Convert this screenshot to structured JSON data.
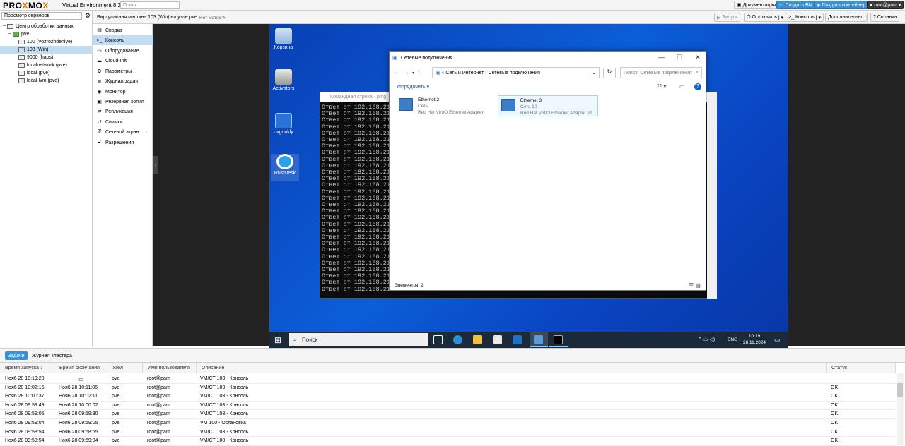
{
  "topbar": {
    "logo_a": "PRO",
    "logo_b": "X",
    "logo_c": "MO",
    "logo_d": "X",
    "version": "Virtual Environment 8.2.2",
    "search_placeholder": "Поиск",
    "docs": "Документация",
    "create_vm": "Создать ВМ",
    "create_ct": "Создать контейнер",
    "user": "root@pam"
  },
  "tree": {
    "view": "Просмотр серверов",
    "items": [
      "Центр обработки данных",
      "pve",
      "100 (Vozrozhdeniye)",
      "103 (Win)",
      "9000 (haos)",
      "localnetwork (pve)",
      "local (pve)",
      "local-lvm (pve)"
    ]
  },
  "vmhead": {
    "title": "Виртуальная машина 103 (Win) на узле pve",
    "tags": "Нет меток",
    "start": "Запуск",
    "shutdown": "Отключить",
    "console": "Консоль",
    "more": "Дополнительно",
    "help": "Справка"
  },
  "menu": [
    "Сводка",
    "Консоль",
    "Оборудование",
    "Cloud-Init",
    "Параметры",
    "Журнал задач",
    "Монитор",
    "Резервная копия",
    "Репликация",
    "Снимки",
    "Сетевой экран",
    "Разрешения"
  ],
  "desktop": {
    "icons": [
      "Корзина",
      "Activators",
      "ovgonkly",
      "RustDesk"
    ],
    "cmd_title": "Командная строка - ping",
    "cmd_line": "Ответ от 192.168.213.",
    "explorer": {
      "title": "Сетевые подключения",
      "path1": "Сеть и Интернет",
      "path2": "Сетевые подключения",
      "search": "Поиск: Сетевые подключения",
      "organize": "Упорядочить ▾",
      "status": "Элементов: 2",
      "adapters": [
        {
          "name": "Ethernet 2",
          "net": "Сеть",
          "dev": "Red Hat VirtIO Ethernet Adapter"
        },
        {
          "name": "Ethernet 3",
          "net": "Сеть 10",
          "dev": "Red Hat VirtIO Ethernet Adapter #2"
        }
      ]
    },
    "taskbar": {
      "search": "Поиск",
      "lang": "ENG",
      "time": "10:19",
      "date": "28.11.2024"
    }
  },
  "tasks": {
    "tab_tasks": "Задачи",
    "tab_log": "Журнал кластера",
    "headers": [
      "Время запуска ↓",
      "Время окончания",
      "Узел",
      "Имя пользователя",
      "Описание",
      "Статус"
    ],
    "rows": [
      [
        "Ноя6 28 10:19:20",
        "",
        "pve",
        "root@pam",
        "VM/CT 103 - Консоль",
        ""
      ],
      [
        "Ноя6 28 10:02:15",
        "Ноя6 28 10:11:06",
        "pve",
        "root@pam",
        "VM/CT 103 - Консоль",
        "OK"
      ],
      [
        "Ноя6 28 10:00:37",
        "Ноя6 28 10:02:11",
        "pve",
        "root@pam",
        "VM/CT 103 - Консоль",
        "OK"
      ],
      [
        "Ноя6 28 09:59:49",
        "Ноя6 28 10:00:02",
        "pve",
        "root@pam",
        "VM/CT 103 - Консоль",
        "OK"
      ],
      [
        "Ноя6 28 09:59:05",
        "Ноя6 28 09:59:30",
        "pve",
        "root@pam",
        "VM/CT 103 - Консоль",
        "OK"
      ],
      [
        "Ноя6 28 09:59:04",
        "Ноя6 28 09:59:05",
        "pve",
        "root@pam",
        "VM 100 - Остановка",
        "OK"
      ],
      [
        "Ноя6 28 09:58:54",
        "Ноя6 28 09:58:55",
        "pve",
        "root@pam",
        "VM/CT 103 - Консоль",
        "OK"
      ],
      [
        "Ноя6 28 09:58:54",
        "Ноя6 28 09:59:04",
        "pve",
        "root@pam",
        "VM/CT 100 - Консоль",
        "OK"
      ]
    ]
  }
}
